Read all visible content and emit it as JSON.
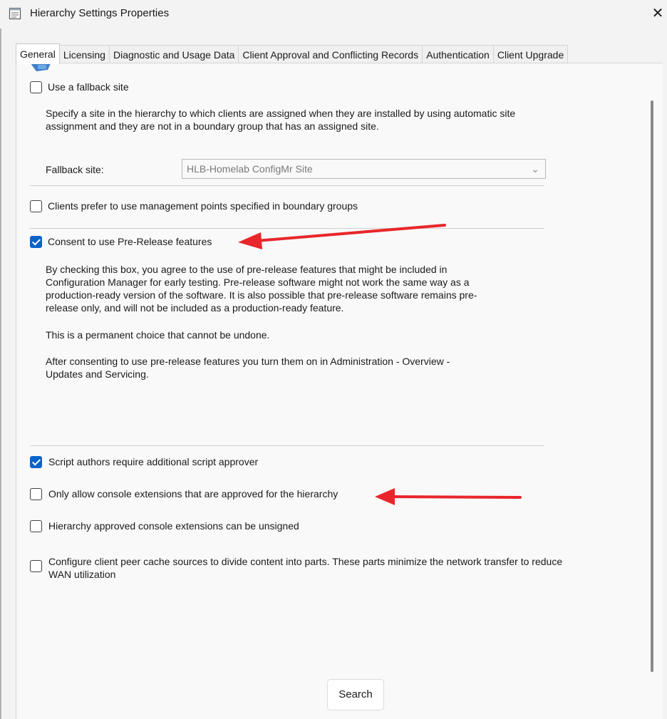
{
  "window": {
    "title": "Hierarchy Settings Properties",
    "close_glyph": "✕"
  },
  "tabs": [
    {
      "label": "General",
      "active": true
    },
    {
      "label": "Licensing",
      "active": false
    },
    {
      "label": "Diagnostic and Usage Data",
      "active": false
    },
    {
      "label": "Client Approval and Conflicting Records",
      "active": false
    },
    {
      "label": "Authentication",
      "active": false
    },
    {
      "label": "Client Upgrade",
      "active": false
    }
  ],
  "fallback": {
    "checkbox_label": "Use a fallback site",
    "checked": false,
    "description": "Specify a site in the hierarchy to which clients are assigned when they are installed by using automatic site assignment and they are not in a boundary group that has an assigned site.",
    "field_label": "Fallback site:",
    "field_value": "HLB-Homelab ConfigMr Site"
  },
  "prefer_mp": {
    "label": "Clients prefer to use management points specified in boundary groups",
    "checked": false
  },
  "prerelease": {
    "label": "Consent to use Pre-Release features",
    "checked": true,
    "description": "By checking this box, you agree to the use of pre-release features that might be included in Configuration Manager for early testing. Pre-release software might not work the same way as a production-ready version of the software. It is also possible that pre-release software remains pre-release only, and will not be included as a production-ready feature.",
    "note": "This is a permanent choice that cannot be undone.",
    "after": "After consenting to use pre-release features you turn them on in Administration - Overview - Updates and Servicing."
  },
  "script_approver": {
    "label": "Script authors require additional script approver",
    "checked": true
  },
  "console_ext": {
    "label": "Only allow console extensions that are approved for the hierarchy",
    "checked": false
  },
  "unsigned_ext": {
    "label": "Hierarchy approved console extensions can be unsigned",
    "checked": false
  },
  "peer_cache": {
    "label": "Configure client peer cache sources to divide content into parts. These parts minimize the network transfer to reduce WAN utilization",
    "checked": false
  },
  "search_button": "Search",
  "icons": [
    "dialog-icon",
    "close-icon",
    "chevron-down-icon",
    "red-arrow-annotation"
  ],
  "colors": {
    "accent": "#0a63c8",
    "annotation": "#e8262b"
  }
}
